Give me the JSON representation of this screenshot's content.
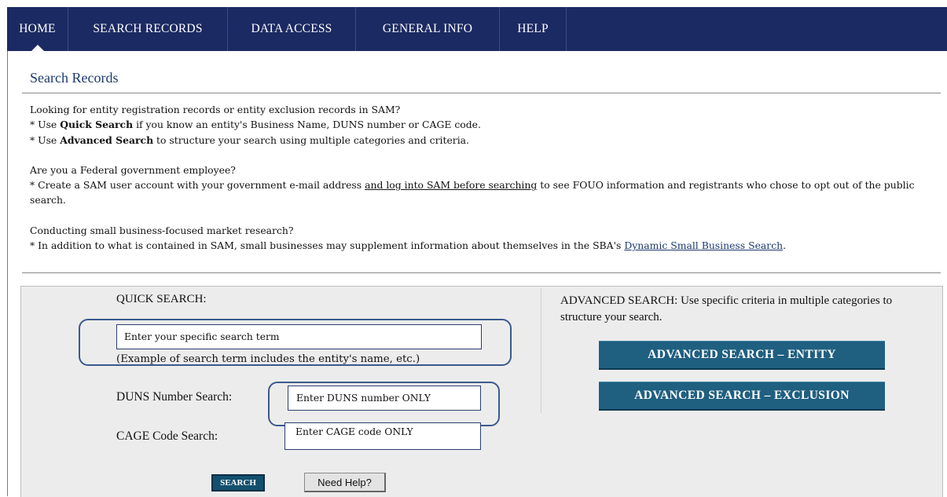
{
  "nav": {
    "items": [
      {
        "label": "HOME"
      },
      {
        "label": "SEARCH RECORDS"
      },
      {
        "label": "DATA ACCESS"
      },
      {
        "label": "GENERAL INFO"
      },
      {
        "label": "HELP"
      }
    ],
    "active": "HOME"
  },
  "page": {
    "title": "Search Records"
  },
  "intro": {
    "p1_line1": "Looking for entity registration records or entity exclusion records in SAM?",
    "p1_line2_pre": "* Use ",
    "p1_line2_bold": "Quick Search",
    "p1_line2_post": " if you know an entity's Business Name, DUNS number or CAGE code.",
    "p1_line3_pre": "* Use ",
    "p1_line3_bold": "Advanced Search",
    "p1_line3_post": " to structure your search using multiple categories and criteria.",
    "p2_line1": "Are you a Federal government employee?",
    "p2_line2_pre": "* Create a SAM user account with your government e-mail address ",
    "p2_line2_link": "and log into SAM before searching",
    "p2_line2_post": " to see FOUO information and registrants who chose to opt out of the public search.",
    "p3_line1": "Conducting small business-focused market research?",
    "p3_line2_pre": "* In addition to what is contained in SAM, small businesses may supplement information about themselves in the SBA's ",
    "p3_line2_link": "Dynamic Small Business Search",
    "p3_line2_post": "."
  },
  "quick_search": {
    "title": "QUICK SEARCH:",
    "term_value": "Enter your specific search term",
    "example": "(Example of search term includes the entity's name, etc.)",
    "duns_label": "DUNS Number Search:",
    "duns_value": "Enter DUNS number ONLY",
    "cage_label": "CAGE Code Search:",
    "cage_value": "Enter CAGE code ONLY",
    "search_button": "SEARCH",
    "help_button": "Need Help?"
  },
  "advanced_search": {
    "description": "ADVANCED SEARCH: Use specific criteria in multiple categories to structure your search.",
    "entity_button": "ADVANCED SEARCH – ENTITY",
    "exclusion_button": "ADVANCED SEARCH – EXCLUSION"
  },
  "colors": {
    "navbar": "#1c2a63",
    "title": "#1c3a6e",
    "adv_button": "#1f5f80",
    "panel": "#ececec"
  }
}
